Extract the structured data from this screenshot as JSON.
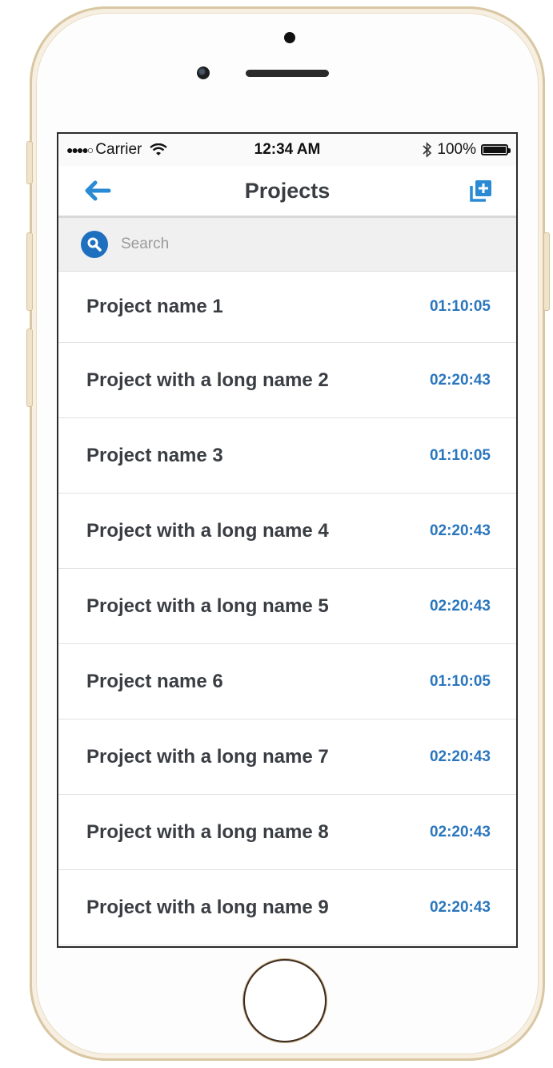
{
  "status_bar": {
    "signal": "●●●●○",
    "carrier": "Carrier",
    "time": "12:34 AM",
    "battery_percent": "100%",
    "battery_level": 1.0
  },
  "navbar": {
    "title": "Projects",
    "back_icon": "arrow-left-icon",
    "add_icon": "add-project-icon",
    "accent_color": "#2a8ad4"
  },
  "search": {
    "placeholder": "Search",
    "icon": "search-icon",
    "icon_color": "#1f6fbf"
  },
  "projects": [
    {
      "name": "Project name 1",
      "time": "01:10:05"
    },
    {
      "name": "Project with a long name 2",
      "time": "02:20:43"
    },
    {
      "name": "Project name 3",
      "time": "01:10:05"
    },
    {
      "name": "Project with a long name 4",
      "time": "02:20:43"
    },
    {
      "name": "Project with a long name 5",
      "time": "02:20:43"
    },
    {
      "name": "Project name 6",
      "time": "01:10:05"
    },
    {
      "name": "Project with a long name 7",
      "time": "02:20:43"
    },
    {
      "name": "Project with a long name 8",
      "time": "02:20:43"
    },
    {
      "name": "Project with a long name 9",
      "time": "02:20:43"
    }
  ],
  "colors": {
    "time_text": "#2a76bd",
    "name_text": "#3a3e43"
  }
}
